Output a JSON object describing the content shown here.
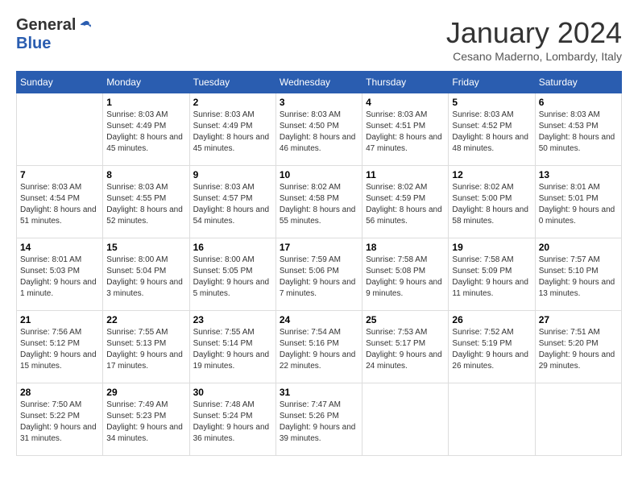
{
  "logo": {
    "general": "General",
    "blue": "Blue"
  },
  "title": {
    "month": "January 2024",
    "location": "Cesano Maderno, Lombardy, Italy"
  },
  "headers": [
    "Sunday",
    "Monday",
    "Tuesday",
    "Wednesday",
    "Thursday",
    "Friday",
    "Saturday"
  ],
  "weeks": [
    [
      {
        "day": "",
        "sunrise": "",
        "sunset": "",
        "daylight": ""
      },
      {
        "day": "1",
        "sunrise": "Sunrise: 8:03 AM",
        "sunset": "Sunset: 4:49 PM",
        "daylight": "Daylight: 8 hours and 45 minutes."
      },
      {
        "day": "2",
        "sunrise": "Sunrise: 8:03 AM",
        "sunset": "Sunset: 4:49 PM",
        "daylight": "Daylight: 8 hours and 45 minutes."
      },
      {
        "day": "3",
        "sunrise": "Sunrise: 8:03 AM",
        "sunset": "Sunset: 4:50 PM",
        "daylight": "Daylight: 8 hours and 46 minutes."
      },
      {
        "day": "4",
        "sunrise": "Sunrise: 8:03 AM",
        "sunset": "Sunset: 4:51 PM",
        "daylight": "Daylight: 8 hours and 47 minutes."
      },
      {
        "day": "5",
        "sunrise": "Sunrise: 8:03 AM",
        "sunset": "Sunset: 4:52 PM",
        "daylight": "Daylight: 8 hours and 48 minutes."
      },
      {
        "day": "6",
        "sunrise": "Sunrise: 8:03 AM",
        "sunset": "Sunset: 4:53 PM",
        "daylight": "Daylight: 8 hours and 50 minutes."
      }
    ],
    [
      {
        "day": "7",
        "sunrise": "Sunrise: 8:03 AM",
        "sunset": "Sunset: 4:54 PM",
        "daylight": "Daylight: 8 hours and 51 minutes."
      },
      {
        "day": "8",
        "sunrise": "Sunrise: 8:03 AM",
        "sunset": "Sunset: 4:55 PM",
        "daylight": "Daylight: 8 hours and 52 minutes."
      },
      {
        "day": "9",
        "sunrise": "Sunrise: 8:03 AM",
        "sunset": "Sunset: 4:57 PM",
        "daylight": "Daylight: 8 hours and 54 minutes."
      },
      {
        "day": "10",
        "sunrise": "Sunrise: 8:02 AM",
        "sunset": "Sunset: 4:58 PM",
        "daylight": "Daylight: 8 hours and 55 minutes."
      },
      {
        "day": "11",
        "sunrise": "Sunrise: 8:02 AM",
        "sunset": "Sunset: 4:59 PM",
        "daylight": "Daylight: 8 hours and 56 minutes."
      },
      {
        "day": "12",
        "sunrise": "Sunrise: 8:02 AM",
        "sunset": "Sunset: 5:00 PM",
        "daylight": "Daylight: 8 hours and 58 minutes."
      },
      {
        "day": "13",
        "sunrise": "Sunrise: 8:01 AM",
        "sunset": "Sunset: 5:01 PM",
        "daylight": "Daylight: 9 hours and 0 minutes."
      }
    ],
    [
      {
        "day": "14",
        "sunrise": "Sunrise: 8:01 AM",
        "sunset": "Sunset: 5:03 PM",
        "daylight": "Daylight: 9 hours and 1 minute."
      },
      {
        "day": "15",
        "sunrise": "Sunrise: 8:00 AM",
        "sunset": "Sunset: 5:04 PM",
        "daylight": "Daylight: 9 hours and 3 minutes."
      },
      {
        "day": "16",
        "sunrise": "Sunrise: 8:00 AM",
        "sunset": "Sunset: 5:05 PM",
        "daylight": "Daylight: 9 hours and 5 minutes."
      },
      {
        "day": "17",
        "sunrise": "Sunrise: 7:59 AM",
        "sunset": "Sunset: 5:06 PM",
        "daylight": "Daylight: 9 hours and 7 minutes."
      },
      {
        "day": "18",
        "sunrise": "Sunrise: 7:58 AM",
        "sunset": "Sunset: 5:08 PM",
        "daylight": "Daylight: 9 hours and 9 minutes."
      },
      {
        "day": "19",
        "sunrise": "Sunrise: 7:58 AM",
        "sunset": "Sunset: 5:09 PM",
        "daylight": "Daylight: 9 hours and 11 minutes."
      },
      {
        "day": "20",
        "sunrise": "Sunrise: 7:57 AM",
        "sunset": "Sunset: 5:10 PM",
        "daylight": "Daylight: 9 hours and 13 minutes."
      }
    ],
    [
      {
        "day": "21",
        "sunrise": "Sunrise: 7:56 AM",
        "sunset": "Sunset: 5:12 PM",
        "daylight": "Daylight: 9 hours and 15 minutes."
      },
      {
        "day": "22",
        "sunrise": "Sunrise: 7:55 AM",
        "sunset": "Sunset: 5:13 PM",
        "daylight": "Daylight: 9 hours and 17 minutes."
      },
      {
        "day": "23",
        "sunrise": "Sunrise: 7:55 AM",
        "sunset": "Sunset: 5:14 PM",
        "daylight": "Daylight: 9 hours and 19 minutes."
      },
      {
        "day": "24",
        "sunrise": "Sunrise: 7:54 AM",
        "sunset": "Sunset: 5:16 PM",
        "daylight": "Daylight: 9 hours and 22 minutes."
      },
      {
        "day": "25",
        "sunrise": "Sunrise: 7:53 AM",
        "sunset": "Sunset: 5:17 PM",
        "daylight": "Daylight: 9 hours and 24 minutes."
      },
      {
        "day": "26",
        "sunrise": "Sunrise: 7:52 AM",
        "sunset": "Sunset: 5:19 PM",
        "daylight": "Daylight: 9 hours and 26 minutes."
      },
      {
        "day": "27",
        "sunrise": "Sunrise: 7:51 AM",
        "sunset": "Sunset: 5:20 PM",
        "daylight": "Daylight: 9 hours and 29 minutes."
      }
    ],
    [
      {
        "day": "28",
        "sunrise": "Sunrise: 7:50 AM",
        "sunset": "Sunset: 5:22 PM",
        "daylight": "Daylight: 9 hours and 31 minutes."
      },
      {
        "day": "29",
        "sunrise": "Sunrise: 7:49 AM",
        "sunset": "Sunset: 5:23 PM",
        "daylight": "Daylight: 9 hours and 34 minutes."
      },
      {
        "day": "30",
        "sunrise": "Sunrise: 7:48 AM",
        "sunset": "Sunset: 5:24 PM",
        "daylight": "Daylight: 9 hours and 36 minutes."
      },
      {
        "day": "31",
        "sunrise": "Sunrise: 7:47 AM",
        "sunset": "Sunset: 5:26 PM",
        "daylight": "Daylight: 9 hours and 39 minutes."
      },
      {
        "day": "",
        "sunrise": "",
        "sunset": "",
        "daylight": ""
      },
      {
        "day": "",
        "sunrise": "",
        "sunset": "",
        "daylight": ""
      },
      {
        "day": "",
        "sunrise": "",
        "sunset": "",
        "daylight": ""
      }
    ]
  ]
}
